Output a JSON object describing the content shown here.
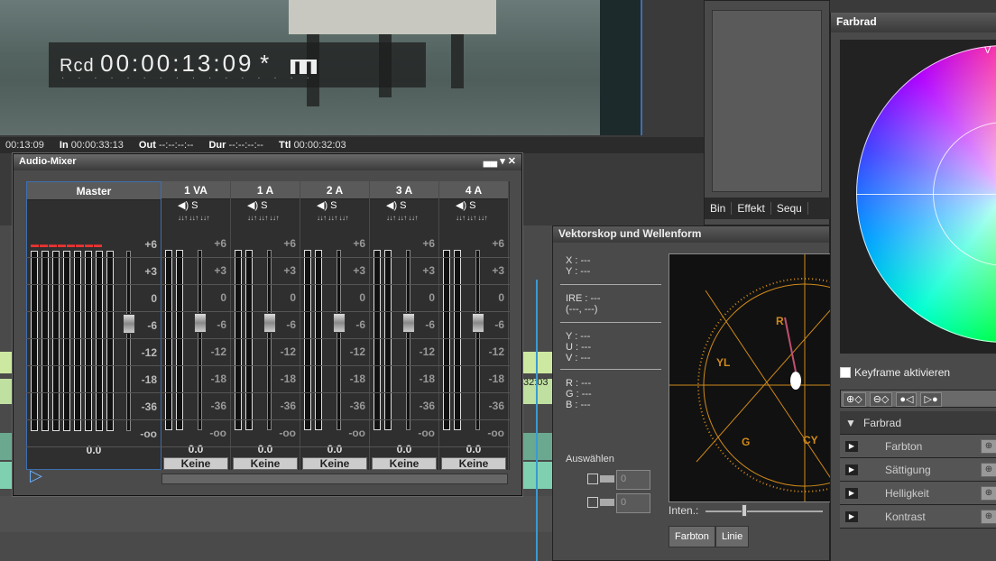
{
  "preview": {
    "rec_label": "Rcd",
    "timecode": "00:00:13:09",
    "asterisk": "*",
    "pause_symbol": "❚❚"
  },
  "timebar": {
    "current": "00:13:09",
    "in_label": "In",
    "in_value": "00:00:33:13",
    "out_label": "Out",
    "out_value": "--:--:--:--",
    "dur_label": "Dur",
    "dur_value": "--:--:--:--",
    "ttl_label": "Ttl",
    "ttl_value": "00:00:32:03"
  },
  "bin_tabs": [
    "Bin",
    "Effekt",
    "Sequ"
  ],
  "mixer": {
    "title": "Audio-Mixer",
    "controls": "▄▄ ▾ ✕",
    "scale": [
      "+6",
      "+3",
      "0",
      "-6",
      "-12",
      "-18",
      "-36",
      "-oo"
    ],
    "channels": [
      {
        "name": "Master",
        "value": "0.0",
        "output": ""
      },
      {
        "name": "1 VA",
        "value": "0.0",
        "output": "Keine",
        "mute": "◀) S",
        "fx": "↓↓↑ ↓↓↑ ↓↓↑"
      },
      {
        "name": "1 A",
        "value": "0.0",
        "output": "Keine",
        "mute": "◀) S",
        "fx": "↓↓↑ ↓↓↑ ↓↓↑"
      },
      {
        "name": "2 A",
        "value": "0.0",
        "output": "Keine",
        "mute": "◀) S",
        "fx": "↓↓↑ ↓↓↑ ↓↓↑"
      },
      {
        "name": "3 A",
        "value": "0.0",
        "output": "Keine",
        "mute": "◀) S",
        "fx": "↓↓↑ ↓↓↑ ↓↓↑"
      },
      {
        "name": "4 A",
        "value": "0.0",
        "output": "Keine",
        "mute": "◀) S",
        "fx": "↓↓↑ ↓↓↑ ↓↓↑"
      }
    ]
  },
  "vektorskop": {
    "title": "Vektorskop und Wellenform",
    "xy": [
      "X : ---",
      "Y : ---"
    ],
    "ire": [
      "IRE : ---",
      " (---, ---)"
    ],
    "yuv": [
      "Y : ---",
      "U : ---",
      "V : ---"
    ],
    "rgb": [
      "R : ---",
      "G : ---",
      "B : ---"
    ],
    "auswahl": "Auswählen",
    "sel_value_1": "0",
    "sel_value_2": "0",
    "inten_label": "Inten.:",
    "btn_farbton": "Farbton",
    "btn_linie": "Linie",
    "scope_labels": [
      "R",
      "YL",
      "G",
      "CY"
    ]
  },
  "farbrad": {
    "title": "Farbrad",
    "v_label": "V",
    "keyframe_label": "Keyframe aktivieren",
    "section": "Farbrad",
    "rows": [
      "Farbton",
      "Sättigung",
      "Helligkeit",
      "Kontrast"
    ]
  },
  "timeline": {
    "left_timecode": "32:03"
  },
  "colors": {
    "accent": "#3f6fb0",
    "scope_orange": "#d08a1a",
    "play": "#6ab0ff"
  }
}
